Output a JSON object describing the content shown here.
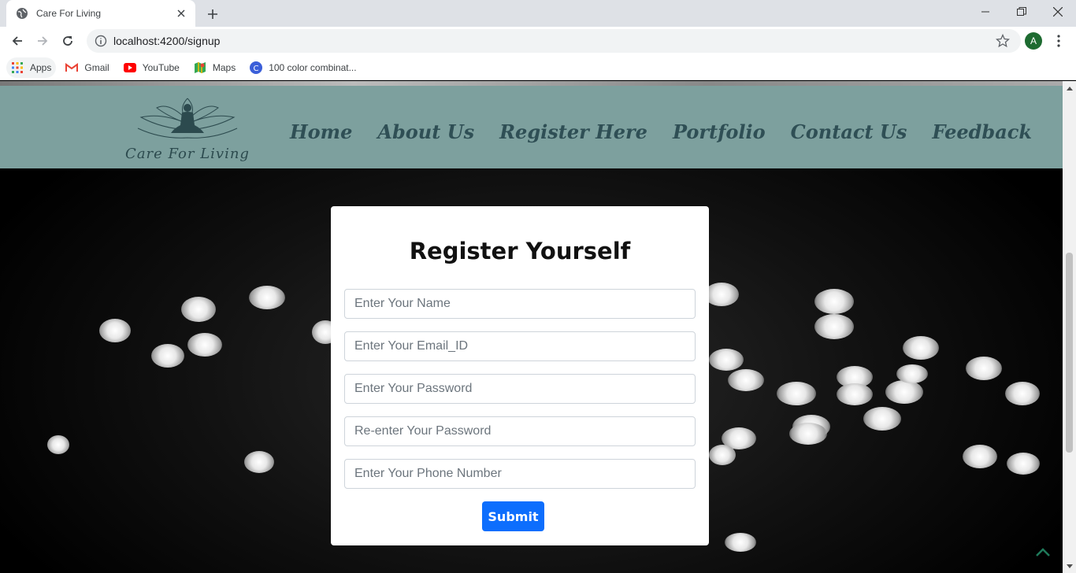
{
  "browser": {
    "tab_title": "Care For Living",
    "url": "localhost:4200/signup",
    "profile_initial": "A",
    "bookmarks": [
      "Apps",
      "Gmail",
      "YouTube",
      "Maps",
      "100 color combinat..."
    ]
  },
  "site": {
    "logo_text": "Care For Living",
    "nav": [
      "Home",
      "About Us",
      "Register Here",
      "Portfolio",
      "Contact Us",
      "Feedback"
    ],
    "accent": "#7da09e"
  },
  "form": {
    "title": "Register Yourself",
    "name_placeholder": "Enter Your Name",
    "email_placeholder": "Enter Your Email_ID",
    "password_placeholder": "Enter Your Password",
    "repassword_placeholder": "Re-enter Your Password",
    "phone_placeholder": "Enter Your Phone Number",
    "submit_label": "Submit",
    "submit_color": "#0d6efd"
  }
}
